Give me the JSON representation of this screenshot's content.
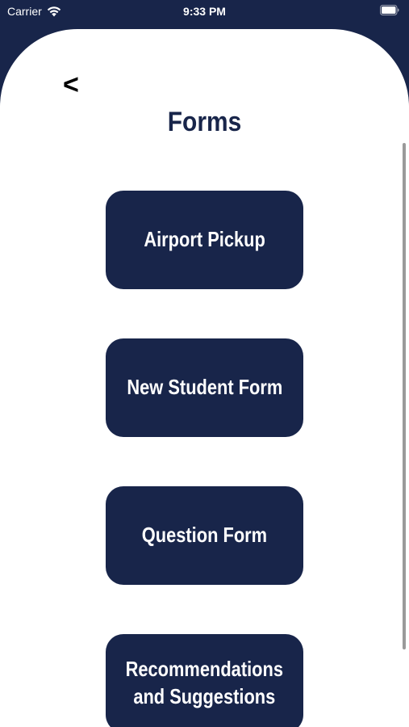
{
  "status_bar": {
    "carrier": "Carrier",
    "time": "9:33 PM",
    "wifi_icon": "wifi-icon",
    "battery_icon": "battery-icon"
  },
  "nav": {
    "back_label": "<"
  },
  "page": {
    "title": "Forms"
  },
  "forms": [
    {
      "label": "Airport Pickup"
    },
    {
      "label": "New Student Form"
    },
    {
      "label": "Question Form"
    },
    {
      "label": "Recommendations\nand Suggestions"
    }
  ],
  "colors": {
    "navy": "#18254a",
    "background": "#ffffff",
    "text_on_button": "#ffffff"
  }
}
